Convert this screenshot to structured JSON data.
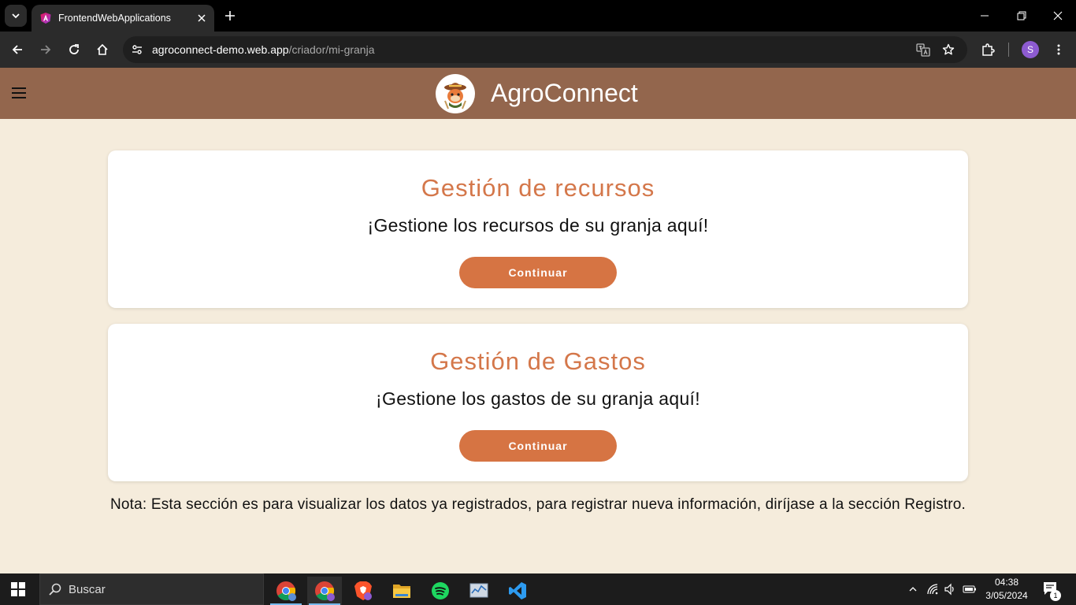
{
  "browser": {
    "tab": {
      "title": "FrontendWebApplications"
    },
    "url": {
      "host": "agroconnect-demo.web.app",
      "path": "/criador/mi-granja"
    },
    "profile_initial": "S"
  },
  "app": {
    "title": "AgroConnect"
  },
  "cards": [
    {
      "title": "Gestión de recursos",
      "text": "¡Gestione los recursos de su granja aquí!",
      "button": "Continuar"
    },
    {
      "title": "Gestión de Gastos",
      "text": "¡Gestione los gastos de su granja aquí!",
      "button": "Continuar"
    }
  ],
  "note": "Nota: Esta sección es para visualizar los datos ya registrados, para registrar nueva información, diríjase a la sección Registro.",
  "taskbar": {
    "search_label": "Buscar",
    "time": "04:38",
    "date": "3/05/2024",
    "notification_count": "1"
  },
  "colors": {
    "header": "#93664d",
    "page_bg": "#f5ecdc",
    "accent": "#d67443",
    "card_title": "#d4774a"
  }
}
